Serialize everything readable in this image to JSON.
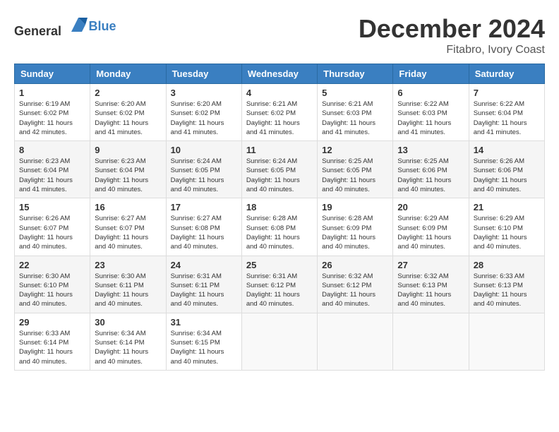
{
  "logo": {
    "general": "General",
    "blue": "Blue"
  },
  "title": "December 2024",
  "subtitle": "Fitabro, Ivory Coast",
  "days_header": [
    "Sunday",
    "Monday",
    "Tuesday",
    "Wednesday",
    "Thursday",
    "Friday",
    "Saturday"
  ],
  "weeks": [
    [
      {
        "day": "1",
        "sunrise": "6:19 AM",
        "sunset": "6:02 PM",
        "daylight": "11 hours and 42 minutes."
      },
      {
        "day": "2",
        "sunrise": "6:20 AM",
        "sunset": "6:02 PM",
        "daylight": "11 hours and 41 minutes."
      },
      {
        "day": "3",
        "sunrise": "6:20 AM",
        "sunset": "6:02 PM",
        "daylight": "11 hours and 41 minutes."
      },
      {
        "day": "4",
        "sunrise": "6:21 AM",
        "sunset": "6:02 PM",
        "daylight": "11 hours and 41 minutes."
      },
      {
        "day": "5",
        "sunrise": "6:21 AM",
        "sunset": "6:03 PM",
        "daylight": "11 hours and 41 minutes."
      },
      {
        "day": "6",
        "sunrise": "6:22 AM",
        "sunset": "6:03 PM",
        "daylight": "11 hours and 41 minutes."
      },
      {
        "day": "7",
        "sunrise": "6:22 AM",
        "sunset": "6:04 PM",
        "daylight": "11 hours and 41 minutes."
      }
    ],
    [
      {
        "day": "8",
        "sunrise": "6:23 AM",
        "sunset": "6:04 PM",
        "daylight": "11 hours and 41 minutes."
      },
      {
        "day": "9",
        "sunrise": "6:23 AM",
        "sunset": "6:04 PM",
        "daylight": "11 hours and 40 minutes."
      },
      {
        "day": "10",
        "sunrise": "6:24 AM",
        "sunset": "6:05 PM",
        "daylight": "11 hours and 40 minutes."
      },
      {
        "day": "11",
        "sunrise": "6:24 AM",
        "sunset": "6:05 PM",
        "daylight": "11 hours and 40 minutes."
      },
      {
        "day": "12",
        "sunrise": "6:25 AM",
        "sunset": "6:05 PM",
        "daylight": "11 hours and 40 minutes."
      },
      {
        "day": "13",
        "sunrise": "6:25 AM",
        "sunset": "6:06 PM",
        "daylight": "11 hours and 40 minutes."
      },
      {
        "day": "14",
        "sunrise": "6:26 AM",
        "sunset": "6:06 PM",
        "daylight": "11 hours and 40 minutes."
      }
    ],
    [
      {
        "day": "15",
        "sunrise": "6:26 AM",
        "sunset": "6:07 PM",
        "daylight": "11 hours and 40 minutes."
      },
      {
        "day": "16",
        "sunrise": "6:27 AM",
        "sunset": "6:07 PM",
        "daylight": "11 hours and 40 minutes."
      },
      {
        "day": "17",
        "sunrise": "6:27 AM",
        "sunset": "6:08 PM",
        "daylight": "11 hours and 40 minutes."
      },
      {
        "day": "18",
        "sunrise": "6:28 AM",
        "sunset": "6:08 PM",
        "daylight": "11 hours and 40 minutes."
      },
      {
        "day": "19",
        "sunrise": "6:28 AM",
        "sunset": "6:09 PM",
        "daylight": "11 hours and 40 minutes."
      },
      {
        "day": "20",
        "sunrise": "6:29 AM",
        "sunset": "6:09 PM",
        "daylight": "11 hours and 40 minutes."
      },
      {
        "day": "21",
        "sunrise": "6:29 AM",
        "sunset": "6:10 PM",
        "daylight": "11 hours and 40 minutes."
      }
    ],
    [
      {
        "day": "22",
        "sunrise": "6:30 AM",
        "sunset": "6:10 PM",
        "daylight": "11 hours and 40 minutes."
      },
      {
        "day": "23",
        "sunrise": "6:30 AM",
        "sunset": "6:11 PM",
        "daylight": "11 hours and 40 minutes."
      },
      {
        "day": "24",
        "sunrise": "6:31 AM",
        "sunset": "6:11 PM",
        "daylight": "11 hours and 40 minutes."
      },
      {
        "day": "25",
        "sunrise": "6:31 AM",
        "sunset": "6:12 PM",
        "daylight": "11 hours and 40 minutes."
      },
      {
        "day": "26",
        "sunrise": "6:32 AM",
        "sunset": "6:12 PM",
        "daylight": "11 hours and 40 minutes."
      },
      {
        "day": "27",
        "sunrise": "6:32 AM",
        "sunset": "6:13 PM",
        "daylight": "11 hours and 40 minutes."
      },
      {
        "day": "28",
        "sunrise": "6:33 AM",
        "sunset": "6:13 PM",
        "daylight": "11 hours and 40 minutes."
      }
    ],
    [
      {
        "day": "29",
        "sunrise": "6:33 AM",
        "sunset": "6:14 PM",
        "daylight": "11 hours and 40 minutes."
      },
      {
        "day": "30",
        "sunrise": "6:34 AM",
        "sunset": "6:14 PM",
        "daylight": "11 hours and 40 minutes."
      },
      {
        "day": "31",
        "sunrise": "6:34 AM",
        "sunset": "6:15 PM",
        "daylight": "11 hours and 40 minutes."
      },
      null,
      null,
      null,
      null
    ]
  ],
  "labels": {
    "sunrise_prefix": "Sunrise: ",
    "sunset_prefix": "Sunset: ",
    "daylight_prefix": "Daylight: "
  }
}
